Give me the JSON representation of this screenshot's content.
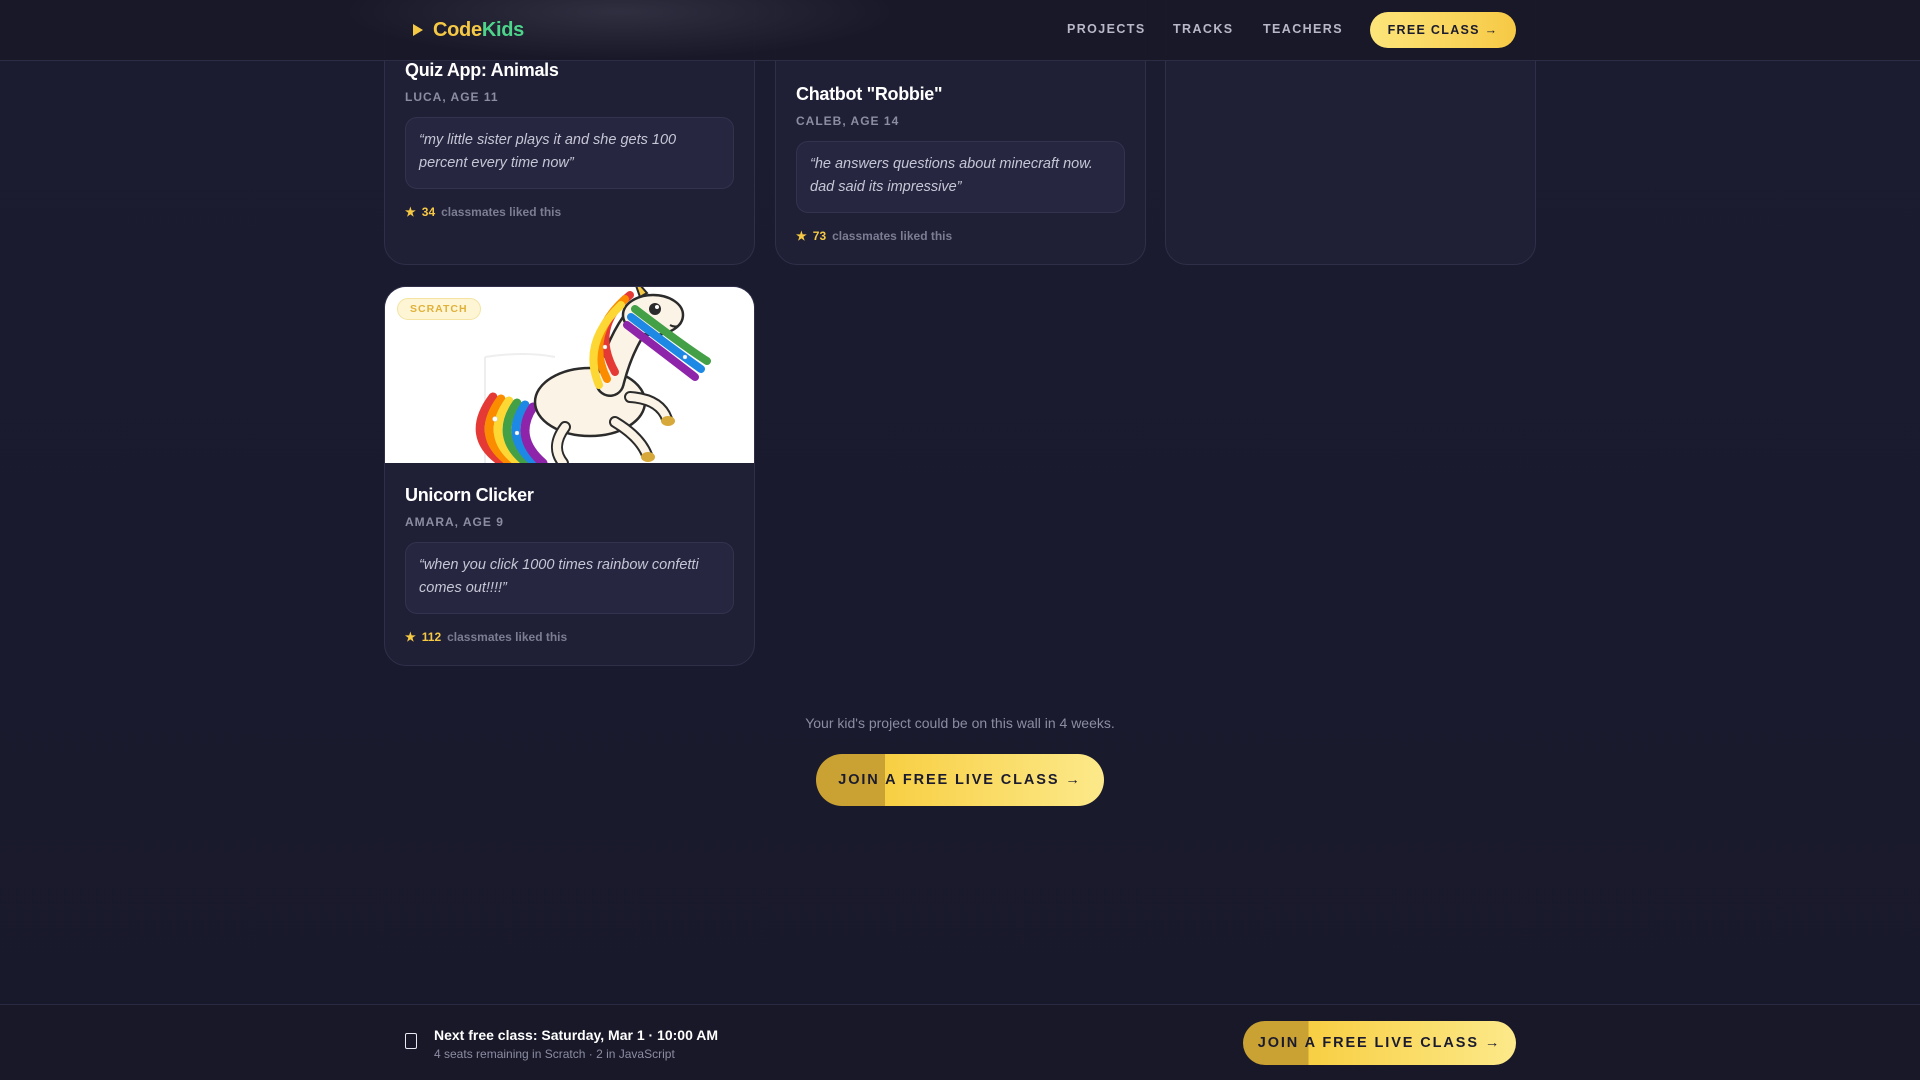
{
  "header": {
    "brand_code": "Code",
    "brand_kids": "Kids",
    "logo_icon": "play-icon",
    "nav": {
      "projects": "PROJECTS",
      "tracks": "TRACKS",
      "teachers": "TEACHERS",
      "cta": "FREE CLASS →"
    }
  },
  "projects": [
    {
      "title": "Quiz App: Animals",
      "author": "LUCA, AGE 11",
      "quote": "“my little sister plays it and she gets 100 percent every time now”",
      "likes": "34",
      "likes_label": "classmates liked this"
    },
    {
      "title": "Chatbot \"Robbie\"",
      "author": "CALEB, AGE 14",
      "quote": "“he answers questions about minecraft now. dad said its impressive”",
      "likes": "73",
      "likes_label": "classmates liked this"
    },
    {
      "tag": "SCRATCH",
      "image": "unicorn-illustration",
      "title": "Unicorn Clicker",
      "author": "AMARA, AGE 9",
      "quote": "“when you click 1000 times rainbow confetti comes out!!!!”",
      "likes": "112",
      "likes_label": "classmates liked this"
    }
  ],
  "wall": {
    "text": "Your kid's project could be on this wall in 4 weeks.",
    "cta": "JOIN A FREE LIVE CLASS →"
  },
  "bottom_bar": {
    "icon": "calendar-icon",
    "next_class": "Next free class: Saturday, Mar 1 · 10:00 AM",
    "seats": "4 seats remaining in Scratch · 2 in JavaScript",
    "cta": "JOIN A FREE LIVE CLASS →"
  },
  "colors": {
    "background": "#1b1b2f",
    "accent_yellow": "#f6c945",
    "brand_green": "#4cd58a",
    "card": "#1f1f36"
  }
}
